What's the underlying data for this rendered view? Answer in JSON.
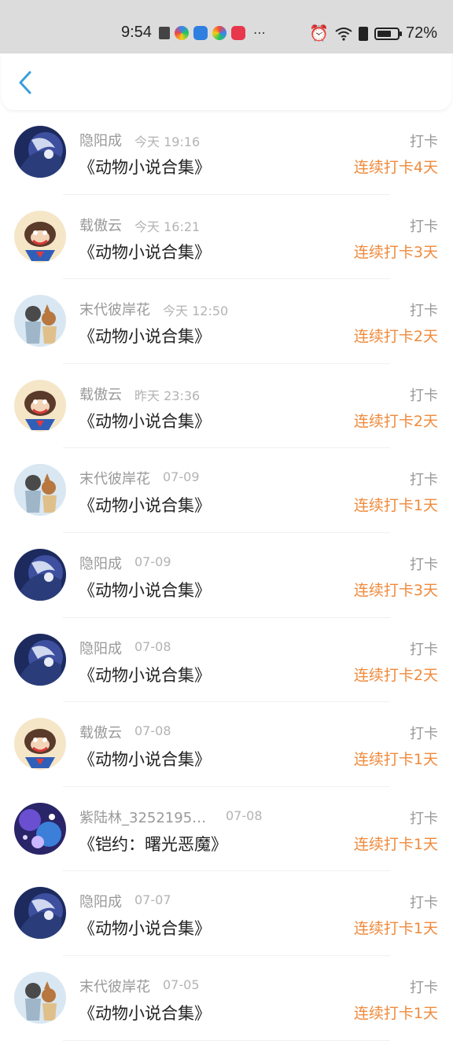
{
  "status": {
    "time": "9:54",
    "battery": "72%",
    "battery_level": 0.72,
    "notification_icons": [
      "alarm-icon",
      "wifi-icon",
      "alert-icon",
      "battery-icon"
    ],
    "app_icons": [
      "app-icon-1",
      "app-icon-2",
      "app-icon-3",
      "app-icon-4"
    ]
  },
  "header": {
    "back_icon": "chevron-left-icon",
    "accent": "#3a9fd9"
  },
  "colors": {
    "streak": "#f08a3c",
    "meta": "#999999"
  },
  "entries": [
    {
      "name": "隐阳成",
      "time": "今天 19:16",
      "book": "《动物小说合集》",
      "action": "打卡",
      "streak": "连续打卡4天",
      "avatar": "anime-avatar"
    },
    {
      "name": "载傲云",
      "time": "今天 16:21",
      "book": "《动物小说合集》",
      "action": "打卡",
      "streak": "连续打卡3天",
      "avatar": "monkey-avatar"
    },
    {
      "name": "末代彼岸花",
      "time": "今天 12:50",
      "book": "《动物小说合集》",
      "action": "打卡",
      "streak": "连续打卡2天",
      "avatar": "cartoon-avatar"
    },
    {
      "name": "载傲云",
      "time": "昨天 23:36",
      "book": "《动物小说合集》",
      "action": "打卡",
      "streak": "连续打卡2天",
      "avatar": "monkey-avatar"
    },
    {
      "name": "末代彼岸花",
      "time": "07-09",
      "book": "《动物小说合集》",
      "action": "打卡",
      "streak": "连续打卡1天",
      "avatar": "cartoon-avatar"
    },
    {
      "name": "隐阳成",
      "time": "07-09",
      "book": "《动物小说合集》",
      "action": "打卡",
      "streak": "连续打卡3天",
      "avatar": "anime-avatar"
    },
    {
      "name": "隐阳成",
      "time": "07-08",
      "book": "《动物小说合集》",
      "action": "打卡",
      "streak": "连续打卡2天",
      "avatar": "anime-avatar"
    },
    {
      "name": "载傲云",
      "time": "07-08",
      "book": "《动物小说合集》",
      "action": "打卡",
      "streak": "连续打卡1天",
      "avatar": "monkey-avatar"
    },
    {
      "name": "紫陆林_32521952...",
      "time": "07-08",
      "book": "《铠约：曙光恶魔》",
      "action": "打卡",
      "streak": "连续打卡1天",
      "avatar": "galaxy-avatar"
    },
    {
      "name": "隐阳成",
      "time": "07-07",
      "book": "《动物小说合集》",
      "action": "打卡",
      "streak": "连续打卡1天",
      "avatar": "anime-avatar"
    },
    {
      "name": "末代彼岸花",
      "time": "07-05",
      "book": "《动物小说合集》",
      "action": "打卡",
      "streak": "连续打卡1天",
      "avatar": "cartoon-avatar"
    }
  ]
}
